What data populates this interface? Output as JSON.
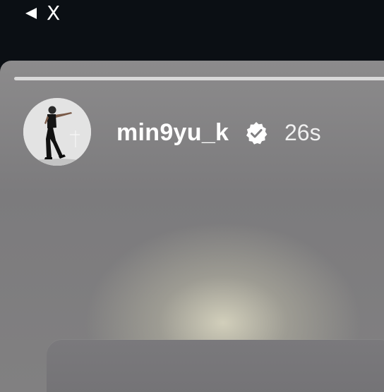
{
  "topbar": {
    "back_icon": "back-triangle-icon",
    "back_label": "X"
  },
  "story": {
    "progress": 1.0,
    "avatar": "profile-photo-man-walking",
    "username": "min9yu_k",
    "verified_icon": "verified-badge-icon",
    "time_ago": "26s"
  },
  "colors": {
    "topbar_bg": "#0b0f14",
    "story_bg": "#808082",
    "text": "#ffffff"
  }
}
